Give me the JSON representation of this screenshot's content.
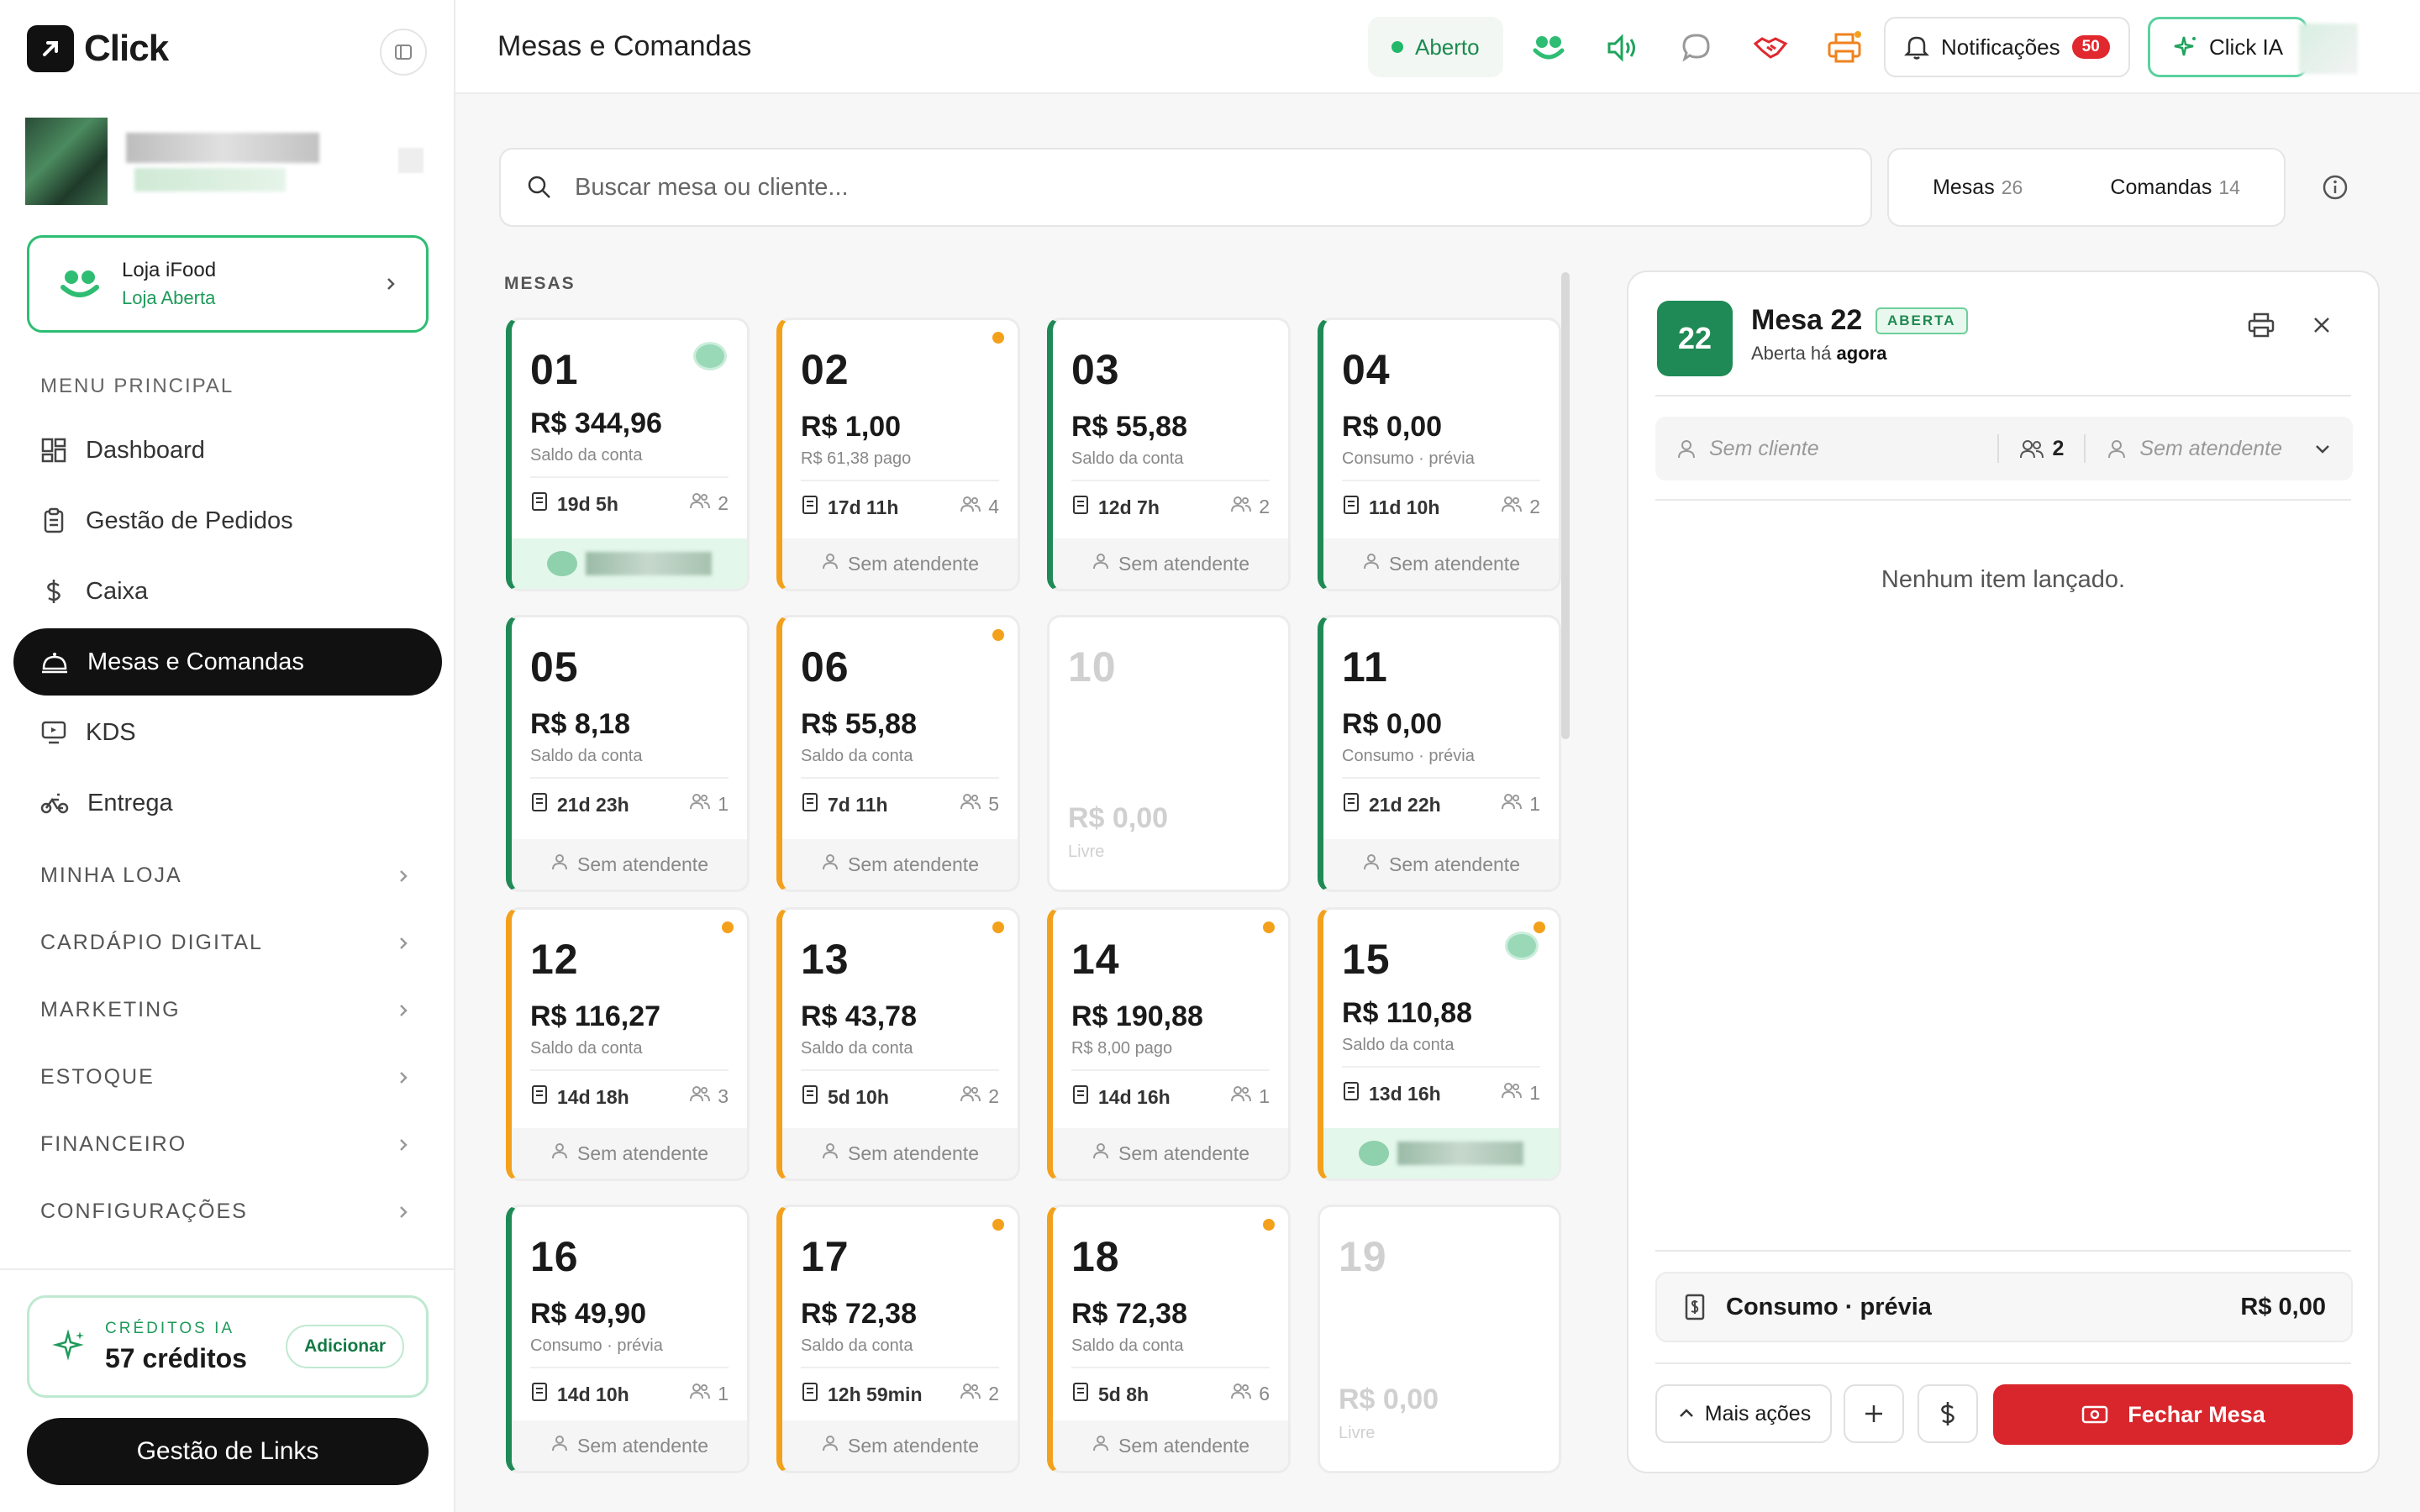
{
  "brand": {
    "name": "Click"
  },
  "ifood": {
    "title": "Loja iFood",
    "status": "Loja Aberta"
  },
  "nav": {
    "section_main": "MENU PRINCIPAL",
    "items": [
      {
        "label": "Dashboard",
        "icon": "grid-icon"
      },
      {
        "label": "Gestão de Pedidos",
        "icon": "clipboard-icon"
      },
      {
        "label": "Caixa",
        "icon": "dollar-icon"
      },
      {
        "label": "Mesas e Comandas",
        "icon": "cloche-icon"
      },
      {
        "label": "KDS",
        "icon": "monitor-icon"
      },
      {
        "label": "Entrega",
        "icon": "bike-icon"
      }
    ],
    "groups": [
      "MINHA LOJA",
      "CARDÁPIO DIGITAL",
      "MARKETING",
      "ESTOQUE",
      "FINANCEIRO",
      "CONFIGURAÇÕES"
    ]
  },
  "credits": {
    "label": "CRÉDITOS IA",
    "value": "57 créditos",
    "add_label": "Adicionar"
  },
  "links_button": "Gestão de Links",
  "topbar": {
    "title": "Mesas e Comandas",
    "status": "Aberto",
    "notifications_label": "Notificações",
    "notifications_count": "50",
    "ia_label": "Click IA"
  },
  "search": {
    "placeholder": "Buscar mesa ou cliente..."
  },
  "tabs": [
    {
      "label": "Mesas",
      "count": "26"
    },
    {
      "label": "Comandas",
      "count": "14"
    }
  ],
  "section_label": "MESAS",
  "colors": {
    "accent_green": "#1f8a55",
    "accent_orange": "#f3a11c",
    "danger": "#d9262c"
  },
  "tables": [
    {
      "num": "01",
      "amount": "R$ 344,96",
      "sub": "Saldo da conta",
      "time": "19d 5h",
      "people": "2",
      "attendant": "",
      "status": "green",
      "dot": false,
      "badge": true,
      "blur": true
    },
    {
      "num": "02",
      "amount": "R$ 1,00",
      "sub": "R$ 61,38 pago",
      "time": "17d 11h",
      "people": "4",
      "attendant": "Sem atendente",
      "status": "orange",
      "dot": true,
      "badge": false,
      "blur": false
    },
    {
      "num": "03",
      "amount": "R$ 55,88",
      "sub": "Saldo da conta",
      "time": "12d 7h",
      "people": "2",
      "attendant": "Sem atendente",
      "status": "green",
      "dot": false,
      "badge": false,
      "blur": false
    },
    {
      "num": "04",
      "amount": "R$ 0,00",
      "sub": "Consumo · prévia",
      "time": "11d 10h",
      "people": "2",
      "attendant": "Sem atendente",
      "status": "green",
      "dot": false,
      "badge": false,
      "blur": false
    },
    {
      "num": "05",
      "amount": "R$ 8,18",
      "sub": "Saldo da conta",
      "time": "21d 23h",
      "people": "1",
      "attendant": "Sem atendente",
      "status": "green",
      "dot": false,
      "badge": false,
      "blur": false
    },
    {
      "num": "06",
      "amount": "R$ 55,88",
      "sub": "Saldo da conta",
      "time": "7d 11h",
      "people": "5",
      "attendant": "Sem atendente",
      "status": "orange",
      "dot": true,
      "badge": false,
      "blur": false
    },
    {
      "num": "10",
      "amount": "R$ 0,00",
      "sub": "Livre",
      "time": "",
      "people": "",
      "attendant": "",
      "status": "free",
      "dot": false,
      "badge": false,
      "blur": false
    },
    {
      "num": "11",
      "amount": "R$ 0,00",
      "sub": "Consumo · prévia",
      "time": "21d 22h",
      "people": "1",
      "attendant": "Sem atendente",
      "status": "green",
      "dot": false,
      "badge": false,
      "blur": false
    },
    {
      "num": "12",
      "amount": "R$ 116,27",
      "sub": "Saldo da conta",
      "time": "14d 18h",
      "people": "3",
      "attendant": "Sem atendente",
      "status": "orange",
      "dot": true,
      "badge": false,
      "blur": false
    },
    {
      "num": "13",
      "amount": "R$ 43,78",
      "sub": "Saldo da conta",
      "time": "5d 10h",
      "people": "2",
      "attendant": "Sem atendente",
      "status": "orange",
      "dot": true,
      "badge": false,
      "blur": false
    },
    {
      "num": "14",
      "amount": "R$ 190,88",
      "sub": "R$ 8,00 pago",
      "time": "14d 16h",
      "people": "1",
      "attendant": "Sem atendente",
      "status": "orange",
      "dot": true,
      "badge": false,
      "blur": false
    },
    {
      "num": "15",
      "amount": "R$ 110,88",
      "sub": "Saldo da conta",
      "time": "13d 16h",
      "people": "1",
      "attendant": "",
      "status": "orange",
      "dot": true,
      "badge": true,
      "blur": true
    },
    {
      "num": "16",
      "amount": "R$ 49,90",
      "sub": "Consumo · prévia",
      "time": "14d 10h",
      "people": "1",
      "attendant": "Sem atendente",
      "status": "green",
      "dot": false,
      "badge": false,
      "blur": false
    },
    {
      "num": "17",
      "amount": "R$ 72,38",
      "sub": "Saldo da conta",
      "time": "12h 59min",
      "people": "2",
      "attendant": "Sem atendente",
      "status": "orange",
      "dot": true,
      "badge": false,
      "blur": false
    },
    {
      "num": "18",
      "amount": "R$ 72,38",
      "sub": "Saldo da conta",
      "time": "5d 8h",
      "people": "6",
      "attendant": "Sem atendente",
      "status": "orange",
      "dot": true,
      "badge": false,
      "blur": false
    },
    {
      "num": "19",
      "amount": "R$ 0,00",
      "sub": "Livre",
      "time": "",
      "people": "",
      "attendant": "",
      "status": "free",
      "dot": false,
      "badge": false,
      "blur": false
    }
  ],
  "panel": {
    "table_number": "22",
    "title": "Mesa 22",
    "status": "ABERTA",
    "opened_prefix": "Aberta há",
    "opened_value": "agora",
    "client_placeholder": "Sem cliente",
    "people": "2",
    "attendant_placeholder": "Sem atendente",
    "empty_message": "Nenhum item lançado.",
    "summary_label": "Consumo · prévia",
    "summary_total": "R$ 0,00",
    "more_actions": "Mais ações",
    "close_label": "Fechar Mesa"
  }
}
